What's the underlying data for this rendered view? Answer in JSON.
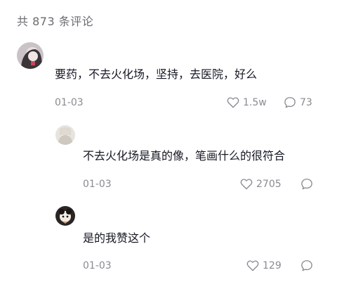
{
  "header": {
    "count_text": "共 873 条评论"
  },
  "comments": [
    {
      "text": "要药，不去火化场，坚持，去医院，好么",
      "date": "01-03",
      "likes": "1.5w",
      "replies": "73"
    },
    {
      "text": "不去火化场是真的像，笔画什么的很符合",
      "date": "01-03",
      "likes": "2705",
      "replies": ""
    },
    {
      "text": "是的我赞这个",
      "date": "01-03",
      "likes": "129",
      "replies": ""
    }
  ],
  "icons": {
    "like": "heart-icon",
    "reply": "comment-bubble-icon"
  },
  "colors": {
    "text": "#161823",
    "muted": "#8a8b91",
    "header": "#6b6b70"
  }
}
